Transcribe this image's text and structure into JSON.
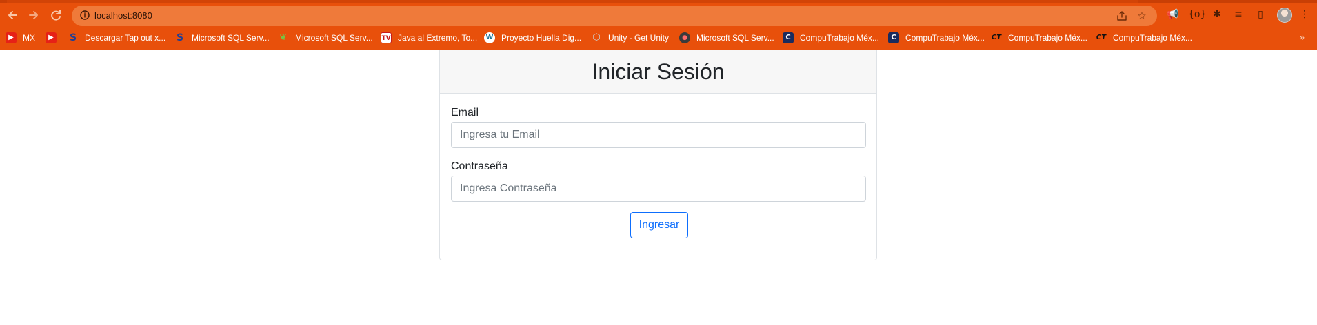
{
  "browser": {
    "url": "localhost:8080",
    "nav": {
      "back_icon": "arrow-left-icon",
      "forward_icon": "arrow-right-icon",
      "reload_icon": "reload-icon"
    },
    "bookmarks": [
      {
        "label": "MX",
        "icon": "youtube-icon"
      },
      {
        "label": "",
        "icon": "youtube-icon"
      },
      {
        "label": "Descargar Tap out x...",
        "icon": "s-logo-icon"
      },
      {
        "label": "Microsoft SQL Serv...",
        "icon": "s-logo-icon"
      },
      {
        "label": "Microsoft SQL Serv...",
        "icon": "green-leaf-icon"
      },
      {
        "label": "Java al Extremo, To...",
        "icon": "tv-logo-icon"
      },
      {
        "label": "Proyecto Huella Dig...",
        "icon": "wordpress-icon"
      },
      {
        "label": "Unity - Get Unity",
        "icon": "unity-icon"
      },
      {
        "label": "Microsoft SQL Serv...",
        "icon": "media-icon"
      },
      {
        "label": "CompuTrabajo Méx...",
        "icon": "computrabajo-icon"
      },
      {
        "label": "CompuTrabajo Méx...",
        "icon": "computrabajo-icon"
      },
      {
        "label": "CompuTrabajo Méx...",
        "icon": "ct-logo-icon"
      },
      {
        "label": "CompuTrabajo Méx...",
        "icon": "ct-logo-icon"
      }
    ],
    "bookmarks_more": "»"
  },
  "login": {
    "title": "Iniciar Sesión",
    "email_label": "Email",
    "email_placeholder": "Ingresa tu Email",
    "email_value": "",
    "password_label": "Contraseña",
    "password_placeholder": "Ingresa Contraseña",
    "password_value": "",
    "submit_label": "Ingresar"
  },
  "colors": {
    "browser_frame": "#e8500b",
    "omnibox": "#ef7a3a",
    "card_header": "#f7f7f7",
    "primary": "#0d6efd"
  }
}
